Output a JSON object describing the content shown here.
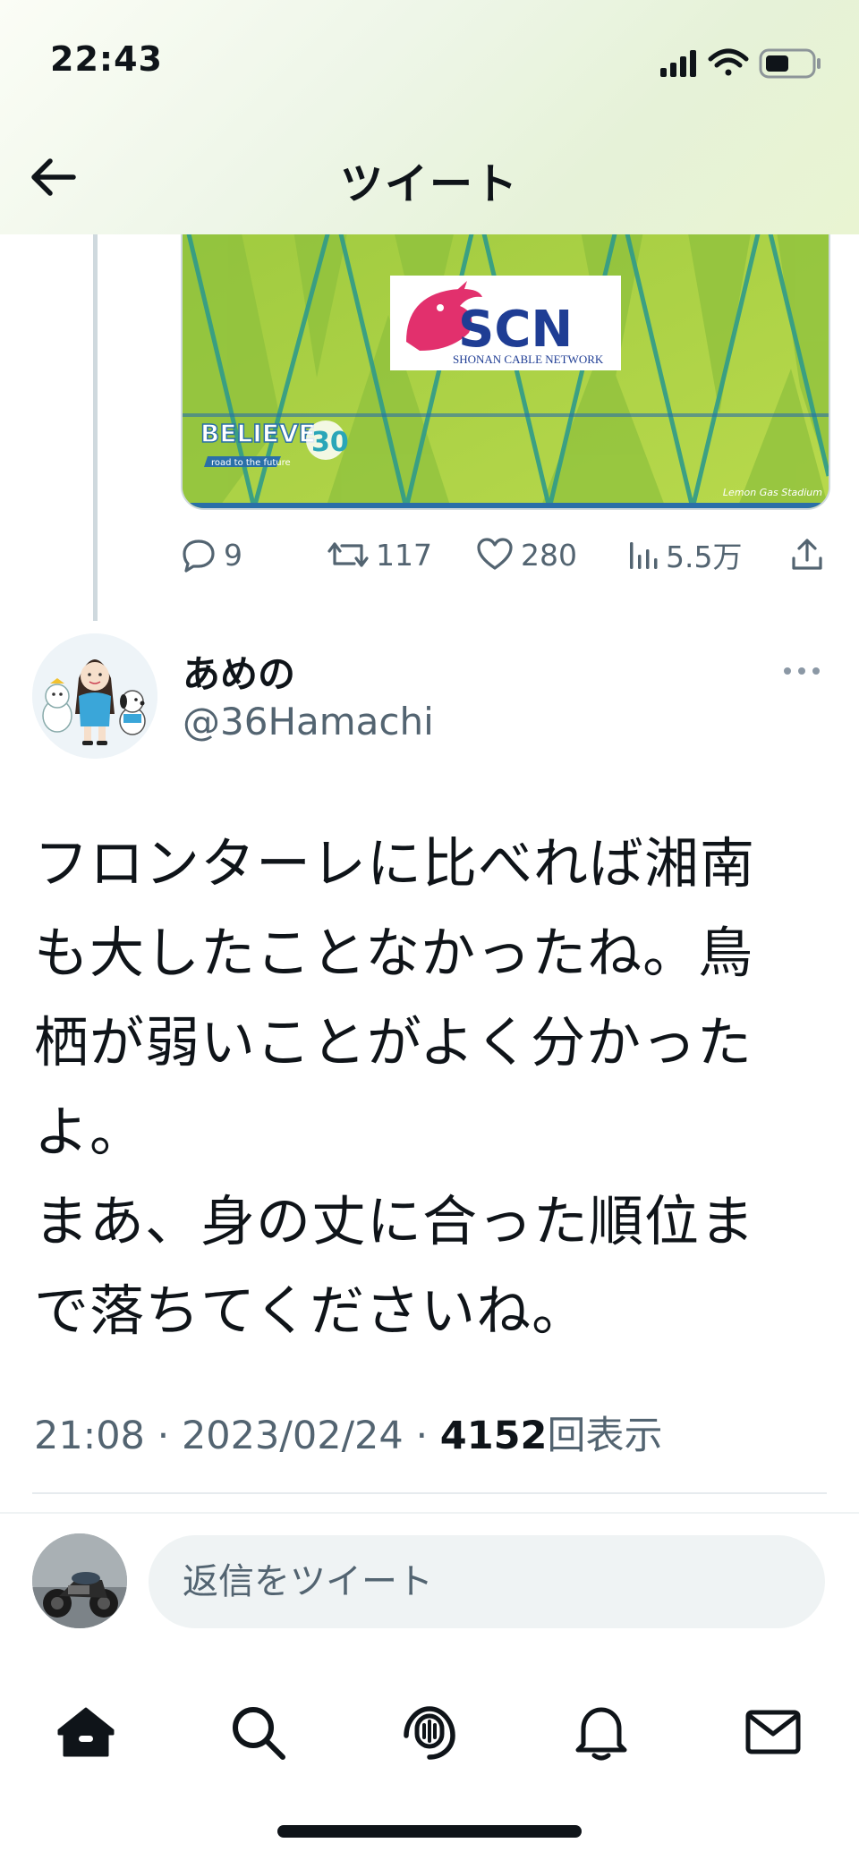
{
  "status_bar": {
    "time": "22:43"
  },
  "header": {
    "title": "ツイート",
    "back_icon": "arrow-left-icon"
  },
  "parent_tweet": {
    "media": {
      "sponsor_text": "SCN",
      "sponsor_subtext": "SHONAN CABLE NETWORK",
      "badge_text": "BELIEVE",
      "badge_subtext": "road to the future",
      "stadium_text": "Lemon Gas Stadium"
    },
    "actions": {
      "replies": "9",
      "retweets": "117",
      "likes": "280",
      "views": "5.5万"
    }
  },
  "tweet": {
    "display_name": "あめの",
    "handle": "@36Hamachi",
    "body": "フロンターレに比べれば湘南\nも大したことなかったね。鳥\n栖が弱いことがよく分かった\nよ。\nまあ、身の丈に合った順位ま\nで落ちてくださいね。",
    "time": "21:08",
    "sep1": " · ",
    "date": "2023/02/24",
    "sep2": " · ",
    "views_count": "4152",
    "views_label": "回表示"
  },
  "reply_bar": {
    "placeholder": "返信をツイート"
  },
  "nav": {
    "items": [
      "home-icon",
      "search-icon",
      "spaces-icon",
      "bell-icon",
      "mail-icon"
    ]
  },
  "colors": {
    "text": "#0f1419",
    "secondary": "#536471",
    "field_green": "#a7cf43",
    "line_blue": "#2a6fa8",
    "logo_pink": "#e2306d"
  }
}
